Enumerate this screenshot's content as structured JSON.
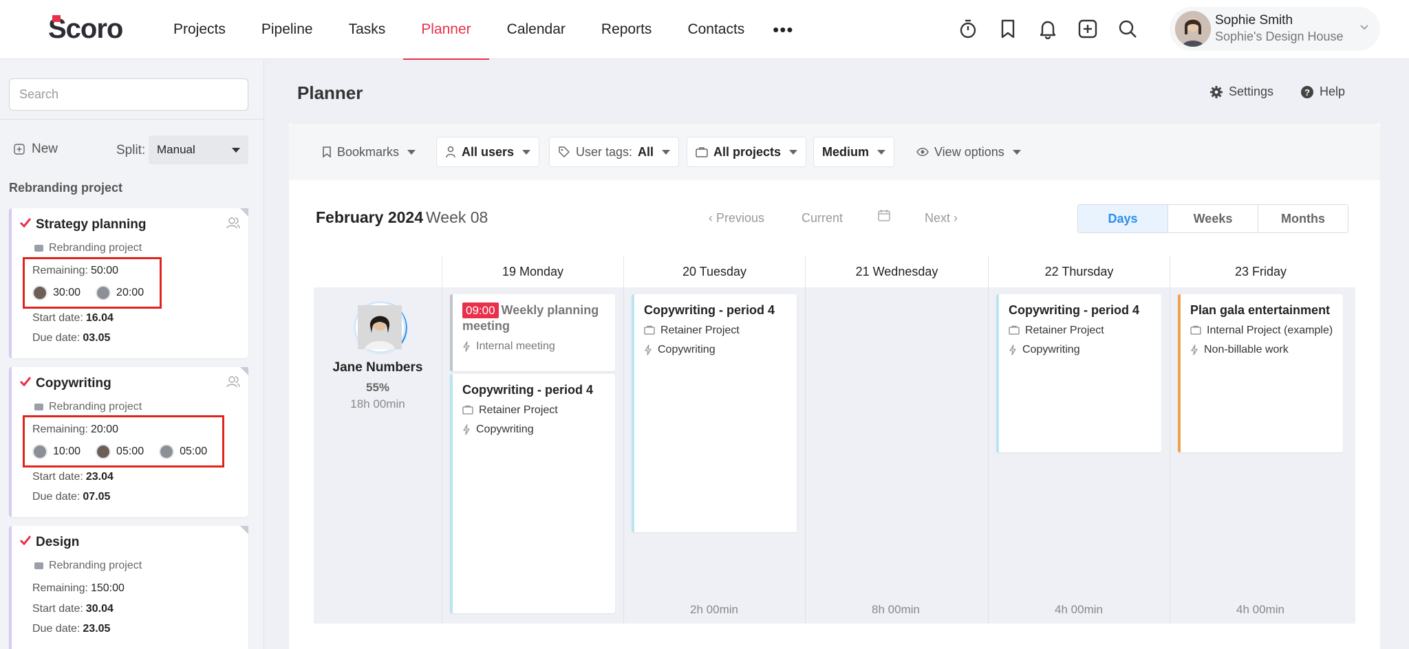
{
  "brand": {
    "name": "Scoro",
    "accent": "#e8304a"
  },
  "nav": [
    "Projects",
    "Pipeline",
    "Tasks",
    "Planner",
    "Calendar",
    "Reports",
    "Contacts"
  ],
  "nav_active": "Planner",
  "nav_more": "•••",
  "top_icons": [
    "timer-icon",
    "bookmark-icon",
    "bell-icon",
    "add-icon",
    "search-icon"
  ],
  "user": {
    "name": "Sophie Smith",
    "company": "Sophie's Design House"
  },
  "sidebar": {
    "search_placeholder": "Search",
    "new_label": "New",
    "split_label": "Split:",
    "split_value": "Manual",
    "group_title": "Rebranding project",
    "remaining_label": "Remaining:",
    "start_label": "Start date:",
    "due_label": "Due date:",
    "tasks": [
      {
        "title": "Strategy planning",
        "project": "Rebranding project",
        "remaining": "50:00",
        "allocations": [
          "30:00",
          "20:00"
        ],
        "start": "16.04",
        "due": "03.05"
      },
      {
        "title": "Copywriting",
        "project": "Rebranding project",
        "remaining": "20:00",
        "allocations": [
          "10:00",
          "05:00",
          "05:00"
        ],
        "start": "23.04",
        "due": "07.05"
      },
      {
        "title": "Design",
        "project": "Rebranding project",
        "remaining": "150:00",
        "start": "30.04",
        "due": "23.05"
      }
    ]
  },
  "main": {
    "title": "Planner",
    "settings_label": "Settings",
    "help_label": "Help",
    "filters": {
      "bookmarks": "Bookmarks",
      "users": "All users",
      "user_tags_label": "User tags:",
      "user_tags_value": "All",
      "projects": "All projects",
      "size": "Medium",
      "view_options": "View options"
    },
    "month": "February 2024",
    "week": "Week 08",
    "prev_label": "Previous",
    "current_label": "Current",
    "next_label": "Next",
    "views": [
      "Days",
      "Weeks",
      "Months"
    ],
    "active_view": "Days",
    "days": [
      "19 Monday",
      "20 Tuesday",
      "21 Wednesday",
      "22 Thursday",
      "23 Friday"
    ],
    "day_totals": [
      "",
      "2h 00min",
      "8h 00min",
      "4h 00min",
      "4h 00min"
    ],
    "person": {
      "name": "Jane Numbers",
      "utilization": "55%",
      "hours": "18h 00min"
    },
    "events": {
      "mon_meeting": {
        "time": "09:00",
        "title": "Weekly planning meeting",
        "type": "Internal meeting"
      },
      "mon_copy": {
        "title": "Copywriting - period 4",
        "project": "Retainer Project",
        "type": "Copywriting"
      },
      "tue_copy": {
        "title": "Copywriting - period 4",
        "project": "Retainer Project",
        "type": "Copywriting"
      },
      "thu_copy": {
        "title": "Copywriting - period 4",
        "project": "Retainer Project",
        "type": "Copywriting"
      },
      "fri_gala": {
        "title": "Plan gala entertainment",
        "project": "Internal Project (example)",
        "type": "Non-billable work"
      }
    }
  }
}
